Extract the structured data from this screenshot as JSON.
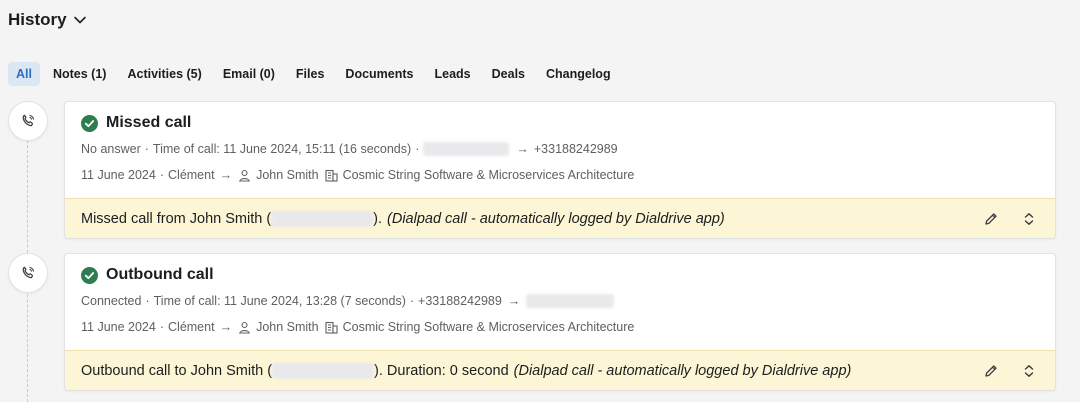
{
  "header": {
    "title": "History"
  },
  "tabs": [
    {
      "label": "All",
      "active": true
    },
    {
      "label": "Notes (1)"
    },
    {
      "label": "Activities (5)"
    },
    {
      "label": "Email (0)"
    },
    {
      "label": "Files"
    },
    {
      "label": "Documents"
    },
    {
      "label": "Leads"
    },
    {
      "label": "Deals"
    },
    {
      "label": "Changelog"
    }
  ],
  "colors": {
    "success": "#2e7d4f",
    "note_bg": "#fcf5d6",
    "active_tab_text": "#2d6ec8"
  },
  "cards": [
    {
      "title": "Missed call",
      "meta1": {
        "status": "No answer",
        "time_label": "Time of call: 11 June 2024, 15:11 (16 seconds)",
        "sep": "·",
        "arrow": "→",
        "to_number": "+33188242989"
      },
      "meta2": {
        "date": "11 June 2024",
        "sep": "·",
        "owner": "Clément",
        "arrow": "→",
        "contact": "John Smith",
        "company": "Cosmic String Software & Microservices Architecture"
      },
      "note": {
        "prefix": "Missed call from John Smith (",
        "suffix": ").",
        "italic": "(Dialpad call - automatically logged by Dialdrive app)"
      }
    },
    {
      "title": "Outbound call",
      "meta1": {
        "status": "Connected",
        "time_label": "Time of call: 11 June 2024, 13:28 (7 seconds)",
        "sep": "·",
        "from_number": "+33188242989",
        "arrow": "→"
      },
      "meta2": {
        "date": "11 June 2024",
        "sep": "·",
        "owner": "Clément",
        "arrow": "→",
        "contact": "John Smith",
        "company": "Cosmic String Software & Microservices Architecture"
      },
      "note": {
        "prefix": "Outbound call to John Smith (",
        "suffix": "). Duration: 0 second",
        "italic": "(Dialpad call - automatically logged by Dialdrive app)"
      }
    }
  ]
}
